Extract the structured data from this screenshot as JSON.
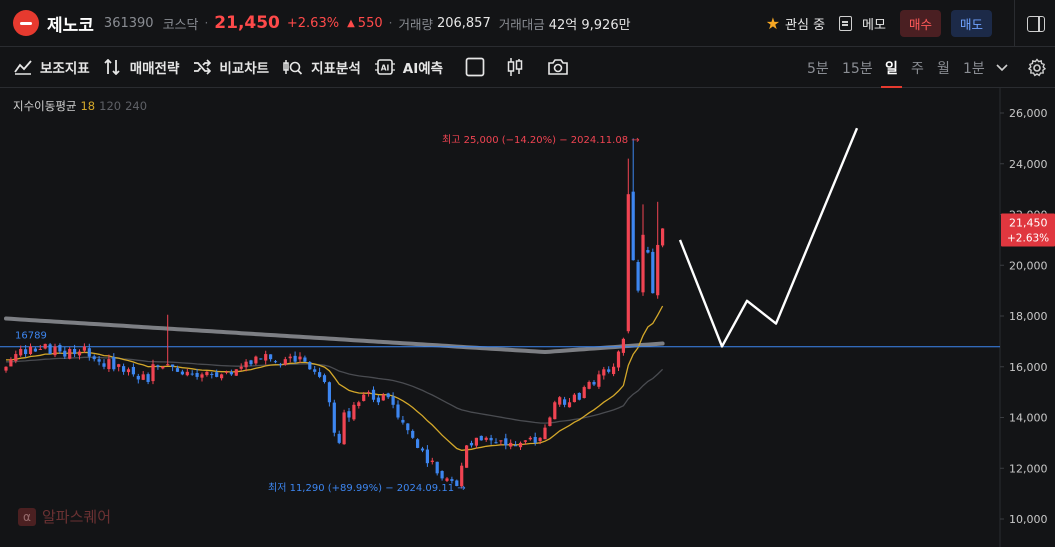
{
  "header": {
    "name": "제노코",
    "code": "361390",
    "market": "코스닥",
    "price": "21,450",
    "change_pct": "+2.63%",
    "change_amt": "550",
    "volume_label": "거래량",
    "volume": "206,857",
    "trade_value_label": "거래대금",
    "trade_value": "42억 9,926만",
    "watch_label": "관심 중",
    "memo_label": "메모",
    "buy_label": "매수",
    "sell_label": "매도"
  },
  "colors": {
    "up": "#f04452",
    "down": "#3d86f0",
    "accent": "#e63a2f"
  },
  "toolbar": {
    "tools": [
      "보조지표",
      "매매전략",
      "비교차트",
      "지표분석",
      "AI예측"
    ],
    "timeframes": [
      "5분",
      "15분",
      "일",
      "주",
      "월",
      "1분"
    ],
    "active_timeframe": "일"
  },
  "ma_legend": {
    "title": "지수이동평균",
    "p1": "18",
    "p2": "120",
    "p3": "240"
  },
  "watermark": "알파스퀘어",
  "chart_data": {
    "type": "candlestick",
    "y_axis": {
      "ticks": [
        10000,
        12000,
        14000,
        16000,
        18000,
        20000,
        22000,
        24000,
        26000
      ],
      "tick_labels": [
        "10,000",
        "12,000",
        "14,000",
        "16,000",
        "18,000",
        "20,000",
        "22,000",
        "24,000",
        "26,000"
      ],
      "range": [
        9700,
        26400
      ]
    },
    "last_price_label": "21,450",
    "last_change_label": "+2.63%",
    "horizontal_line": {
      "value": 16789,
      "label": "16789"
    },
    "high_annotation": "최고 25,000 (−14.20%) − 2024.11.08",
    "low_annotation": "최저 11,290 (+89.99%) − 2024.09.11",
    "closes": [
      16000,
      16300,
      16500,
      16700,
      16500,
      16800,
      16600,
      16700,
      16900,
      16500,
      16800,
      16600,
      16400,
      16700,
      16500,
      16600,
      16800,
      16400,
      16300,
      16200,
      16000,
      16300,
      15900,
      16100,
      15800,
      15900,
      15700,
      15500,
      15700,
      15400,
      16100,
      16000,
      16000,
      16100,
      16000,
      15800,
      15700,
      15800,
      15700,
      15600,
      15700,
      15800,
      15700,
      15600,
      15700,
      15800,
      15700,
      15900,
      16000,
      16200,
      16100,
      16400,
      16300,
      16500,
      16300,
      16200,
      16100,
      16300,
      16400,
      16200,
      16400,
      16200,
      15900,
      15800,
      15600,
      15400,
      14600,
      13400,
      13000,
      14200,
      14000,
      14500,
      14600,
      14900,
      15000,
      14700,
      14600,
      14900,
      14800,
      14500,
      14000,
      13800,
      13500,
      13200,
      12800,
      12700,
      12200,
      12300,
      11800,
      11600,
      11600,
      11500,
      11300,
      12100,
      12900,
      12900,
      13200,
      13100,
      13200,
      13100,
      13000,
      13100,
      12900,
      13000,
      12900,
      13000,
      13100,
      13200,
      13000,
      13200,
      13600,
      14000,
      14600,
      14800,
      14500,
      14600,
      14900,
      14700,
      15200,
      15400,
      15300,
      15700,
      15900,
      15800,
      16000,
      16600,
      17100,
      22800,
      20200,
      19000,
      21200,
      20500,
      18900,
      20800,
      21450
    ],
    "ma_fast": {
      "name": "EMA 18"
    },
    "ma_mid": {
      "name": "EMA 120"
    },
    "ma_slow": {
      "name": "EMA 240"
    },
    "projection": [
      21000,
      16800,
      18600,
      17700,
      25400
    ]
  }
}
